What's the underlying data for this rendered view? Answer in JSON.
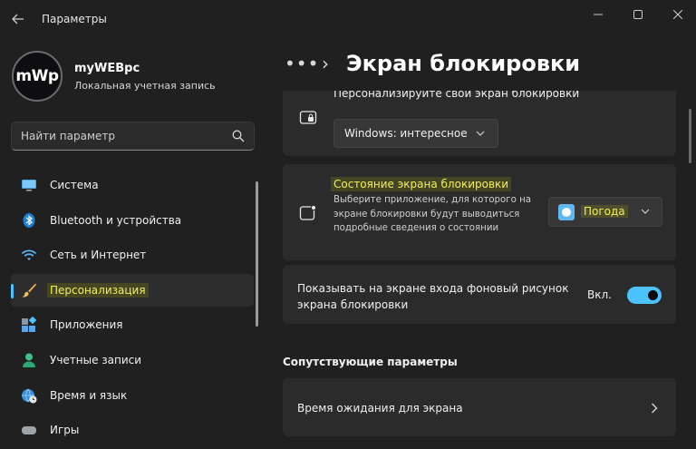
{
  "window": {
    "title": "Параметры",
    "back_icon": "arrow-left-icon",
    "controls": [
      "minimize-icon",
      "maximize-icon",
      "close-icon"
    ]
  },
  "profile": {
    "avatar_text": "mWp",
    "name": "myWEBpc",
    "account_type": "Локальная учетная запись"
  },
  "search": {
    "placeholder": "Найти параметр",
    "icon": "search-icon"
  },
  "nav": {
    "items": [
      {
        "label": "Система",
        "icon": "monitor-icon"
      },
      {
        "label": "Bluetooth и устройства",
        "icon": "bluetooth-icon"
      },
      {
        "label": "Сеть и Интернет",
        "icon": "wifi-icon"
      },
      {
        "label": "Персонализация",
        "icon": "brush-icon",
        "active": true
      },
      {
        "label": "Приложения",
        "icon": "apps-icon"
      },
      {
        "label": "Учетные записи",
        "icon": "person-icon"
      },
      {
        "label": "Время и язык",
        "icon": "globe-clock-icon"
      },
      {
        "label": "Игры",
        "icon": "gamepad-icon"
      }
    ]
  },
  "header": {
    "more": "•••",
    "separator": "›",
    "title": "Экран блокировки"
  },
  "cards": {
    "personalize": {
      "title": "Персонализируйте свой экран блокировки",
      "dropdown_value": "Windows: интересное",
      "icon": "lock-screen-icon"
    },
    "status": {
      "title": "Состояние экрана блокировки",
      "description": "Выберите приложение, для которого на экране блокировки будут выводиться подробные сведения о состоянии",
      "dropdown_value": "Погода",
      "icon": "lock-status-icon",
      "app_icon": "weather-app-icon"
    },
    "signin_background": {
      "label": "Показывать на экране входа фоновый рисунок экрана блокировки",
      "state_label": "Вкл.",
      "toggle_on": true
    }
  },
  "related": {
    "section_title": "Сопутствующие параметры",
    "items": [
      {
        "label": "Время ожидания для экрана"
      }
    ]
  },
  "colors": {
    "accent": "#4cc2ff",
    "highlight": "#f2ef5a",
    "background": "#202020",
    "card": "#2b2b2b"
  }
}
